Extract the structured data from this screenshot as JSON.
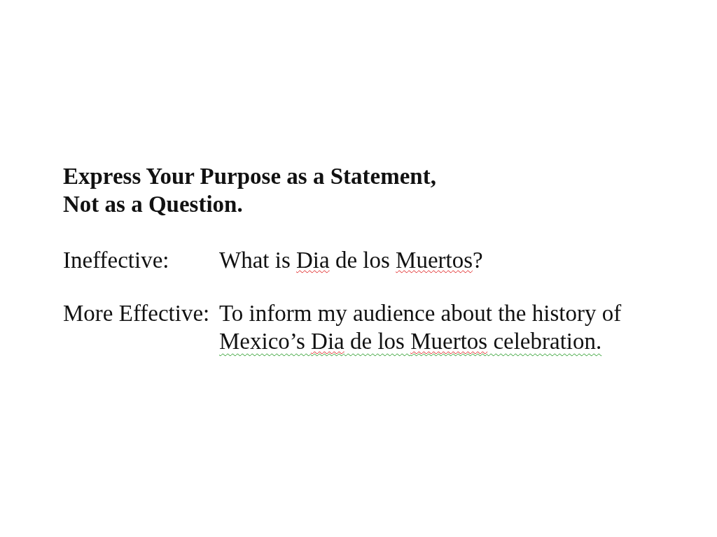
{
  "heading": [
    "Express Your Purpose as a Statement,",
    "Not as a Question."
  ],
  "examples": [
    {
      "label": "Ineffective:",
      "lines": [
        [
          {
            "text": "What is ",
            "spelling": false,
            "grammar": false
          },
          {
            "text": "Dia",
            "spelling": true,
            "grammar": false
          },
          {
            "text": " de los ",
            "spelling": false,
            "grammar": false
          },
          {
            "text": "Muertos",
            "spelling": true,
            "grammar": false
          },
          {
            "text": "?",
            "spelling": false,
            "grammar": false
          }
        ]
      ]
    },
    {
      "label": "More Effective:",
      "lines": [
        [
          {
            "text": "To inform my audience about the history of",
            "spelling": false,
            "grammar": false
          }
        ],
        [
          {
            "text": "Mexico’s ",
            "spelling": false,
            "grammar": true
          },
          {
            "text": "Dia",
            "spelling": true,
            "grammar": true
          },
          {
            "text": " de los ",
            "spelling": false,
            "grammar": true
          },
          {
            "text": "Muertos",
            "spelling": true,
            "grammar": true
          },
          {
            "text": " celebration.",
            "spelling": false,
            "grammar": true
          }
        ]
      ]
    }
  ]
}
